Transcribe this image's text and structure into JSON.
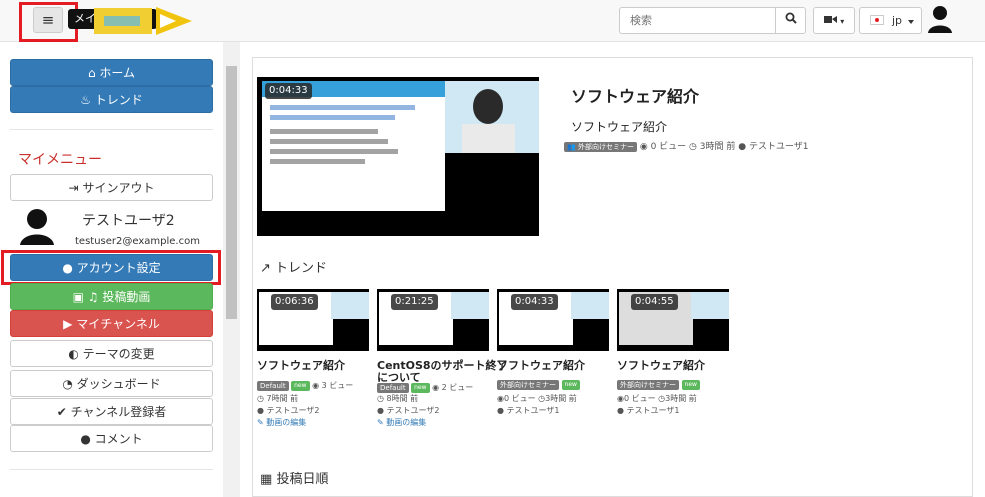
{
  "header": {
    "menu_button": "≡",
    "tooltip": "メインメニュー",
    "search_placeholder": "検索",
    "lang": "jp"
  },
  "sidebar": {
    "home": "ホーム",
    "trend": "トレンド",
    "my_menu": "マイメニュー",
    "sign_out": "サインアウト",
    "user_name": "テストユーザ2",
    "user_email": "testuser2@example.com",
    "account_settings": "アカウント設定",
    "post_video": "投稿動画",
    "my_channel": "マイチャンネル",
    "theme": "テーマの変更",
    "dashboard": "ダッシュボード",
    "subscriptions": "チャンネル登録者",
    "comments": "コメント"
  },
  "featured": {
    "time": "0:04:33",
    "title": "ソフトウェア紹介",
    "desc": "ソフトウェア紹介",
    "tag": "外部向けセミナー",
    "views": "0 ビュー",
    "ago": "3時間 前",
    "user": "テストユーザ1"
  },
  "sections": {
    "trend": "トレンド",
    "posted": "投稿日順"
  },
  "cards": [
    {
      "time": "0:06:36",
      "title": "ソフトウェア紹介",
      "title2": "",
      "tag": "Default",
      "views": "3 ビュー",
      "ago": "7時間 前",
      "user": "テストユーザ2",
      "edit": "動画の編集"
    },
    {
      "time": "0:21:25",
      "title": "CentOS8のサポート終了",
      "title2": "について",
      "tag": "Default",
      "views": "2 ビュー",
      "ago": "8時間 前",
      "user": "テストユーザ2",
      "edit": "動画の編集"
    },
    {
      "time": "0:04:33",
      "title": "ソフトウェア紹介",
      "title2": "",
      "tag": "外部向けセミナー",
      "views": "0 ビュー",
      "ago": "3時間 前",
      "user": "テストユーザ1",
      "edit": ""
    },
    {
      "time": "0:04:55",
      "title": "ソフトウェア紹介",
      "title2": "",
      "tag": "外部向けセミナー",
      "views": "0 ビュー",
      "ago": "3時間 前",
      "user": "テストユーザ1",
      "edit": ""
    }
  ],
  "new_label": "new"
}
